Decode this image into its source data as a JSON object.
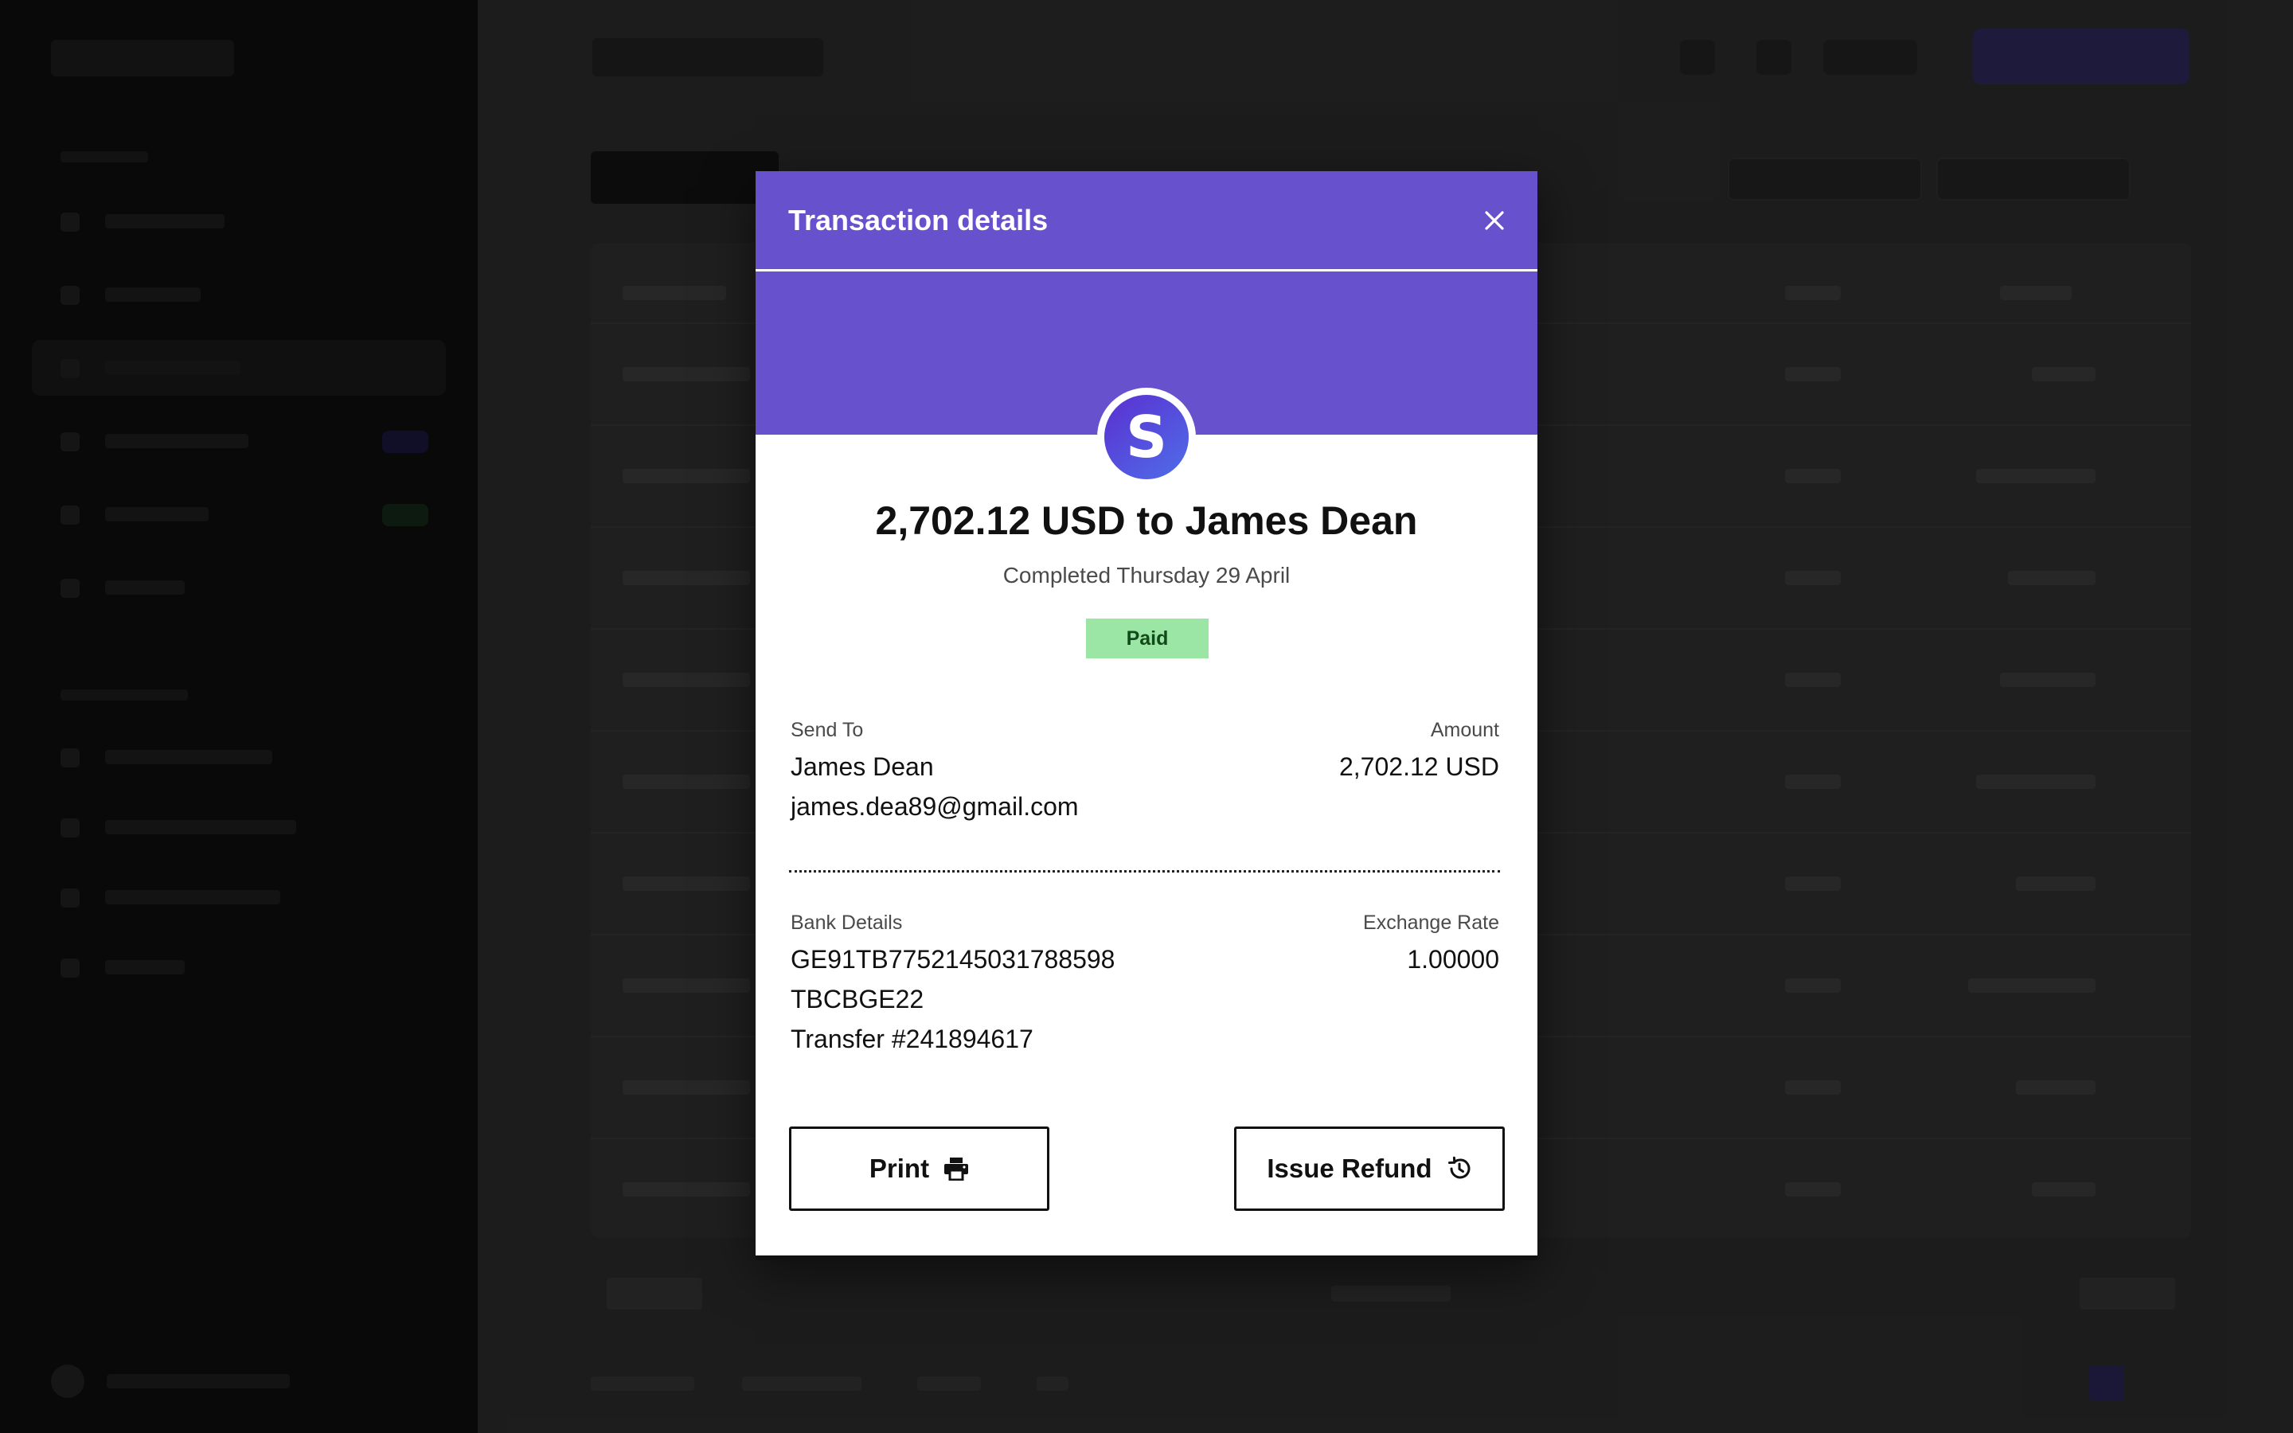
{
  "modal": {
    "title": "Transaction details",
    "avatar_letter": "S",
    "headline": "2,702.12 USD to James Dean",
    "subline": "Completed Thursday 29 April",
    "status_badge": "Paid",
    "send_to": {
      "label": "Send To",
      "name": "James Dean",
      "email": "james.dea89@gmail.com"
    },
    "amount": {
      "label": "Amount",
      "value": "2,702.12 USD"
    },
    "bank_details": {
      "label": "Bank Details",
      "iban": "GE91TB7752145031788598",
      "swift": "TBCBGE22",
      "transfer": "Transfer #241894617"
    },
    "exchange_rate": {
      "label": "Exchange Rate",
      "value": "1.00000"
    },
    "buttons": {
      "print": "Print",
      "refund": "Issue Refund"
    },
    "icons": {
      "close": "close-icon",
      "print": "printer-icon",
      "refund": "history-icon"
    }
  },
  "colors": {
    "modal_header": "#6751cd",
    "paid_badge_bg": "#9be6a4",
    "sidebar_bg": "#0b0b0b",
    "backdrop": "#232323"
  }
}
